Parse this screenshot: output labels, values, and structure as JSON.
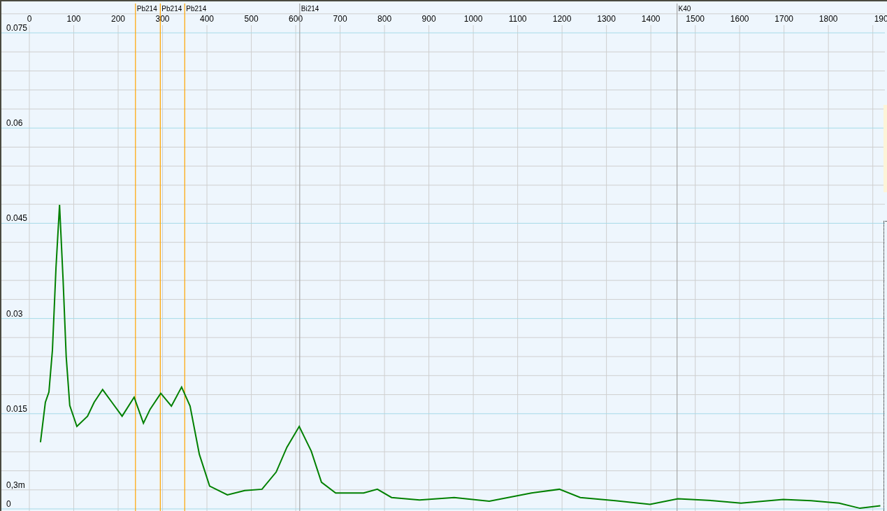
{
  "spectrum": {
    "chart_data": {
      "type": "line",
      "x": [
        25,
        36,
        44,
        52,
        60,
        68,
        76,
        83,
        91,
        107,
        131,
        146,
        165,
        186,
        209,
        236,
        257,
        272,
        296,
        320,
        343,
        362,
        383,
        406,
        446,
        485,
        524,
        556,
        580,
        608,
        635,
        658,
        690,
        753,
        784,
        816,
        879,
        957,
        1036,
        1131,
        1194,
        1241,
        1320,
        1398,
        1461,
        1540,
        1603,
        1698,
        1761,
        1824,
        1871,
        1917
      ],
      "series": [
        {
          "color": "#008000",
          "values": [
            0.0105,
            0.0168,
            0.0184,
            0.025,
            0.038,
            0.0479,
            0.036,
            0.024,
            0.0163,
            0.013,
            0.0146,
            0.0168,
            0.0188,
            0.0168,
            0.0146,
            0.0176,
            0.0135,
            0.0157,
            0.0182,
            0.0162,
            0.0192,
            0.0162,
            0.0086,
            0.0036,
            0.0022,
            0.0029,
            0.0031,
            0.0058,
            0.0097,
            0.013,
            0.0091,
            0.0042,
            0.0025,
            0.0025,
            0.0031,
            0.0018,
            0.0014,
            0.0018,
            0.0012,
            0.0025,
            0.0031,
            0.0018,
            0.0013,
            0.0007,
            0.0016,
            0.0013,
            0.0009,
            0.0015,
            0.0013,
            0.0009,
            0.0001,
            0.0005
          ]
        }
      ],
      "xlim": [
        -63,
        1932
      ],
      "ylim": [
        0,
        0.075
      ],
      "grid": true,
      "xticks": [
        {
          "value": 0,
          "label": "0"
        },
        {
          "value": 100,
          "label": "100"
        },
        {
          "value": 200,
          "label": "200"
        },
        {
          "value": 300,
          "label": "300"
        },
        {
          "value": 400,
          "label": "400"
        },
        {
          "value": 500,
          "label": "500"
        },
        {
          "value": 600,
          "label": "600"
        },
        {
          "value": 700,
          "label": "700"
        },
        {
          "value": 800,
          "label": "800"
        },
        {
          "value": 900,
          "label": "900"
        },
        {
          "value": 1000,
          "label": "1000"
        },
        {
          "value": 1100,
          "label": "1100"
        },
        {
          "value": 1200,
          "label": "1200"
        },
        {
          "value": 1300,
          "label": "1300"
        },
        {
          "value": 1400,
          "label": "1400"
        },
        {
          "value": 1500,
          "label": "1500"
        },
        {
          "value": 1600,
          "label": "1600"
        },
        {
          "value": 1700,
          "label": "1700"
        },
        {
          "value": 1800,
          "label": "1800"
        }
      ],
      "yticks": [
        {
          "value": 0.075,
          "label": "0.075"
        },
        {
          "value": 0.06,
          "label": "0.06"
        },
        {
          "value": 0.045,
          "label": "0.045"
        },
        {
          "value": 0.03,
          "label": "0.03"
        },
        {
          "value": 0.015,
          "label": "0.015"
        },
        {
          "value": 0,
          "label": "0"
        }
      ],
      "ref_lines": [
        {
          "axis": "x",
          "value": 239,
          "label": "Pb214",
          "color": "#ffa500"
        },
        {
          "axis": "x",
          "value": 295,
          "label": "Pb214",
          "color": "#ffa500"
        },
        {
          "axis": "x",
          "value": 350,
          "label": "Pb214",
          "color": "#ffa500"
        },
        {
          "axis": "x",
          "value": 609,
          "label": "Bi214",
          "color": "#a8a8a8"
        },
        {
          "axis": "x",
          "value": 1459,
          "label": "K40",
          "color": "#a8a8a8"
        }
      ]
    },
    "cut_x_label": "190",
    "extra_y_label": "0,3m"
  }
}
